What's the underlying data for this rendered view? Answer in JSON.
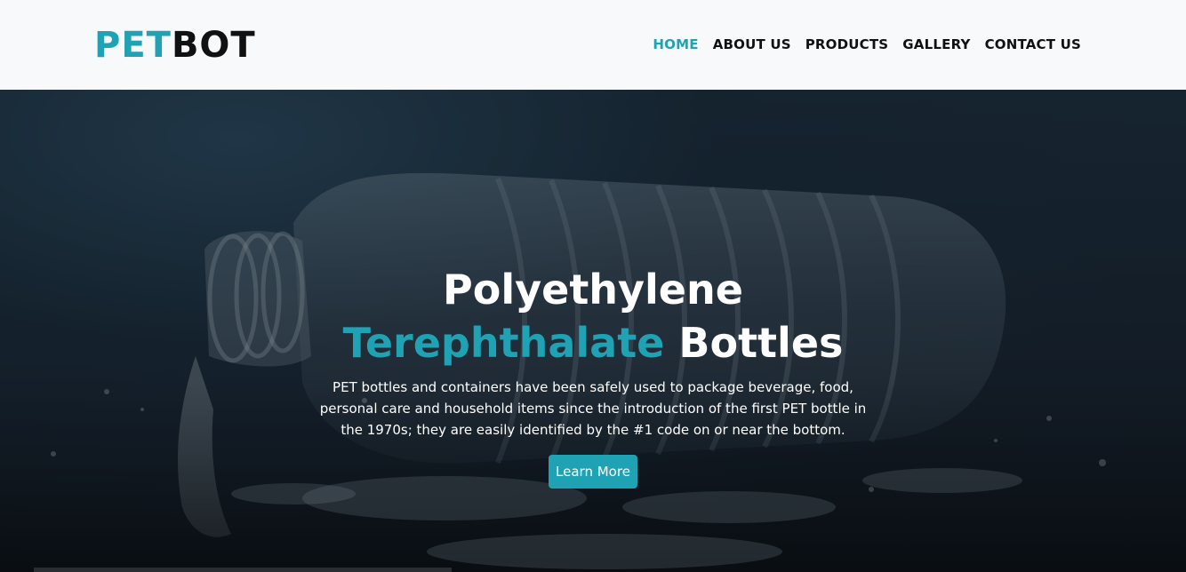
{
  "brand": {
    "part1": "PET",
    "part2": "BOT"
  },
  "nav": {
    "items": [
      {
        "label": "HOME",
        "active": true
      },
      {
        "label": "ABOUT US"
      },
      {
        "label": "PRODUCTS"
      },
      {
        "label": "GALLERY"
      },
      {
        "label": "CONTACT US"
      }
    ]
  },
  "hero": {
    "title_line1": "Polyethylene",
    "title_accent": "Terephthalate",
    "title_rest": "Bottles",
    "description": "PET bottles and containers have been safely used to package beverage, food, personal care and household items since the introduction of the first PET bottle in the 1970s; they are easily identified by the #1 code on or near the bottom.",
    "button_label": "Learn More",
    "background_image": "plastic-bottle-water-splash-image"
  },
  "colors": {
    "accent": "#1fa2b4",
    "navbar_bg": "#f8f9fa",
    "text_dark": "#111111"
  }
}
